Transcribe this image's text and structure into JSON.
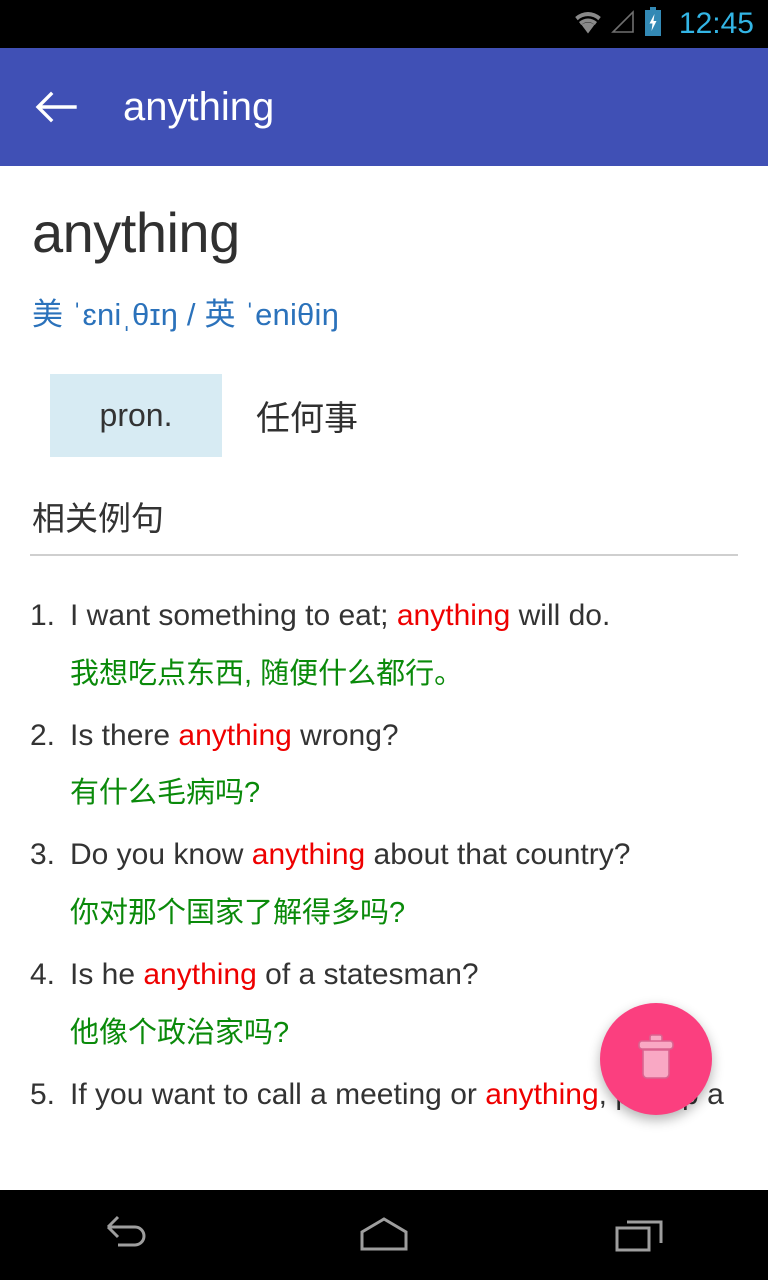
{
  "status_bar": {
    "time": "12:45",
    "wifi_icon": "wifi-icon",
    "signal_icon": "cell-signal-icon",
    "battery_icon": "battery-charging-icon",
    "time_color": "#33b5e5",
    "icon_color": "#8a8a8a",
    "battery_color": "#3389b5"
  },
  "app_bar": {
    "title": "anything",
    "back_icon": "back-arrow-icon",
    "background_color": "#4050b5",
    "text_color": "#ffffff"
  },
  "entry": {
    "headword": "anything",
    "phonetics": "美 ˈɛniˌθɪŋ / 英 ˈeniθiŋ",
    "phonetics_color": "#2b72bb",
    "senses": [
      {
        "pos": "pron.",
        "definition": "任何事",
        "badge_color": "#d7ebf3"
      }
    ]
  },
  "examples_section": {
    "title": "相关例句",
    "highlight_color": "#ee0000",
    "translation_color": "#0a8a0a",
    "items": [
      {
        "num": "1.",
        "en_before": "I want something to eat; ",
        "en_highlight": "anything",
        "en_after": " will do.",
        "zh": "我想吃点东西, 随便什么都行。"
      },
      {
        "num": "2.",
        "en_before": "Is there ",
        "en_highlight": "anything",
        "en_after": " wrong?",
        "zh": "有什么毛病吗?"
      },
      {
        "num": "3.",
        "en_before": "Do you know ",
        "en_highlight": "anything",
        "en_after": " about that country?",
        "zh": "你对那个国家了解得多吗?"
      },
      {
        "num": "4.",
        "en_before": "Is he ",
        "en_highlight": "anything",
        "en_after": " of a statesman?",
        "zh": "他像个政治家吗?"
      },
      {
        "num": "5.",
        "en_before": "If you want to call a meeting or ",
        "en_highlight": "anything",
        "en_after": ", put up a",
        "zh": ""
      }
    ]
  },
  "fab": {
    "icon": "trash-icon",
    "background_color": "#fb3f7f",
    "icon_color": "#f9a8c4"
  },
  "nav_bar": {
    "back_icon": "nav-back-icon",
    "home_icon": "nav-home-icon",
    "recents_icon": "nav-recents-icon",
    "icon_color": "#9e9e9e"
  }
}
